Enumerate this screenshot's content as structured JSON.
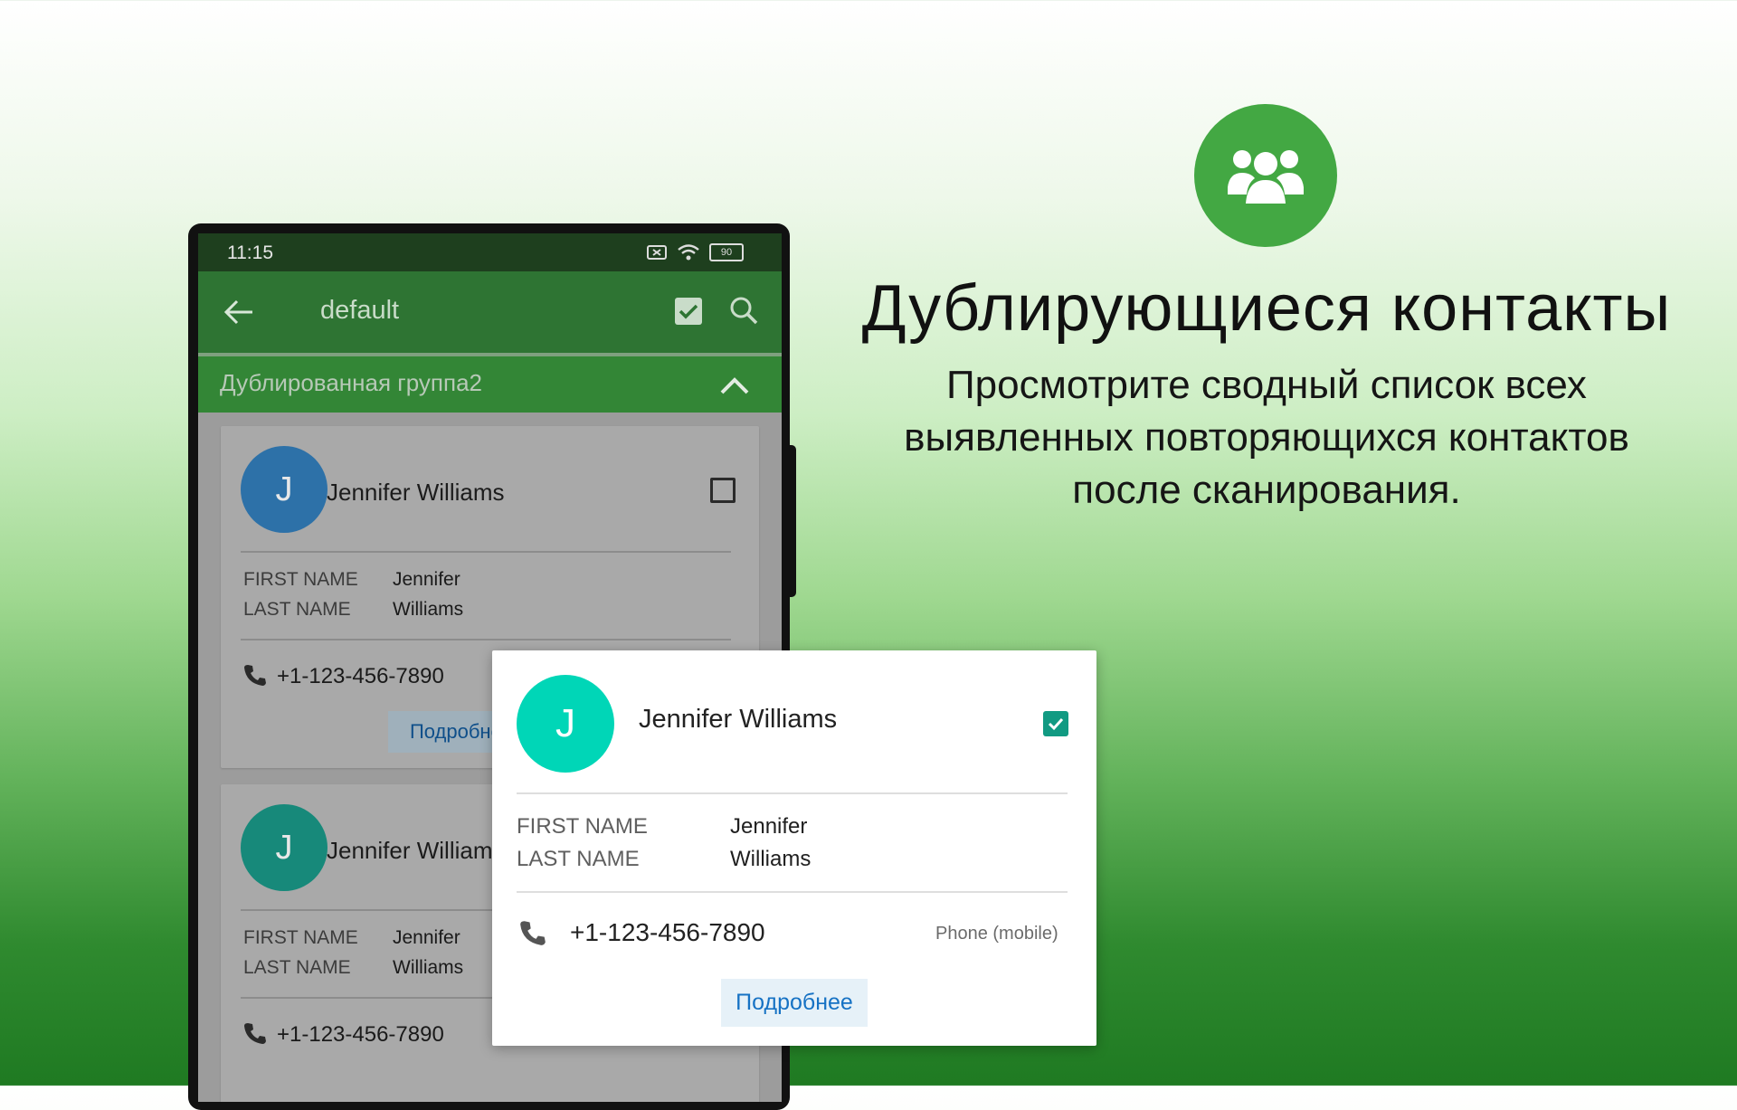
{
  "promo": {
    "title": "Дублирующиеся контакты",
    "subtitle": "Просмотрите сводный список всех выявленных повторяющихся контактов после сканирования."
  },
  "status": {
    "time": "11:15",
    "battery": "90"
  },
  "appbar": {
    "title": "default"
  },
  "group": {
    "title": "Дублированная группа2"
  },
  "labels": {
    "first_name": "FIRST NAME",
    "last_name": "LAST NAME",
    "more": "Подробнее"
  },
  "cards": [
    {
      "initial": "J",
      "name": "Jennifer Williams",
      "first": "Jennifer",
      "last": "Williams",
      "phone": "+1-123-456-7890",
      "avatar_color": "#2d71a8",
      "checked": false
    },
    {
      "initial": "J",
      "name": "Jennifer Williams",
      "first": "Jennifer",
      "last": "Williams",
      "phone": "+1-123-456-7890",
      "avatar_color": "#17897a",
      "checked": false
    }
  ],
  "popup": {
    "initial": "J",
    "name": "Jennifer Williams",
    "first": "Jennifer",
    "last": "Williams",
    "phone": "+1-123-456-7890",
    "phone_type": "Phone (mobile)",
    "checked": true,
    "avatar_color": "#00d6b7"
  },
  "icons": [
    "group-icon",
    "back-arrow-icon",
    "checkbox-icon",
    "search-icon",
    "chevron-up-icon",
    "phone-icon",
    "wifi-icon",
    "battery-icon",
    "sim-icon"
  ],
  "colors": {
    "accent": "#43a843",
    "appbar": "#2e7433",
    "link": "#1672c4"
  }
}
